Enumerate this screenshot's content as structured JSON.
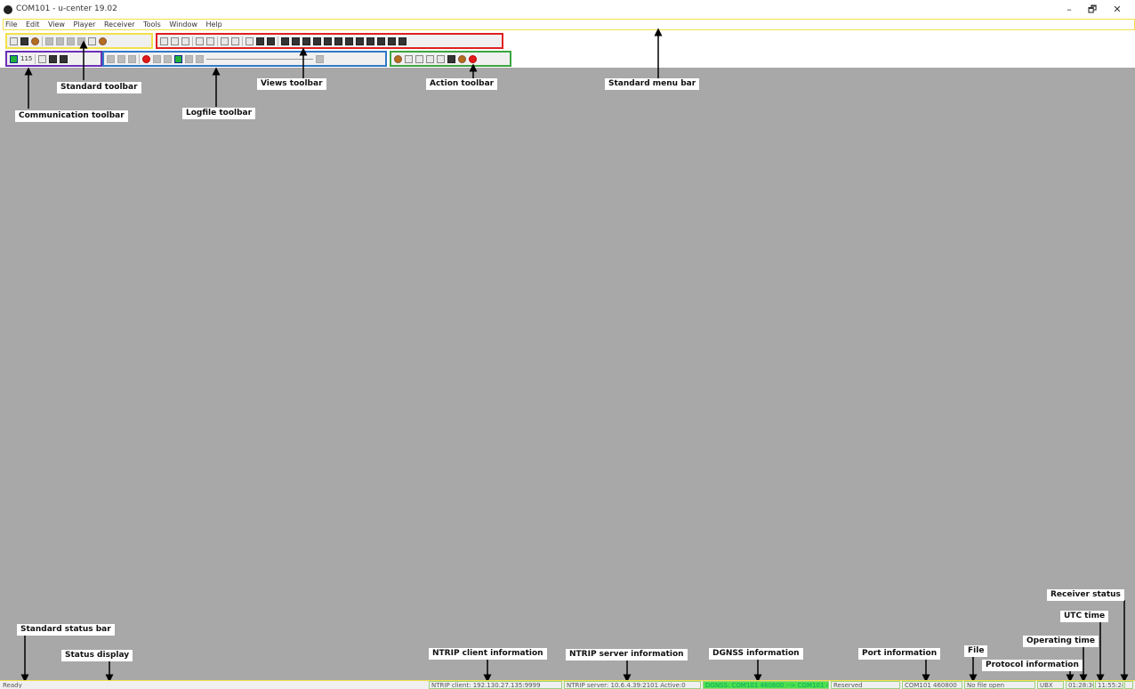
{
  "window": {
    "title": "COM101 - u-center 19.02",
    "controls": [
      "–",
      "🗗",
      "✕"
    ]
  },
  "menu": [
    "File",
    "Edit",
    "View",
    "Player",
    "Receiver",
    "Tools",
    "Window",
    "Help"
  ],
  "comm_toolbar": {
    "baud": "115"
  },
  "annotations": {
    "standard_toolbar": "Standard toolbar",
    "views_toolbar": "Views toolbar",
    "action_toolbar": "Action toolbar",
    "standard_menu_bar": "Standard menu bar",
    "communication_toolbar": "Communication toolbar",
    "logfile_toolbar": "Logfile toolbar",
    "standard_status_bar": "Standard status bar",
    "status_display": "Status display",
    "ntrip_client_information": "NTRIP client information",
    "ntrip_server_information": "NTRIP server information",
    "dgnss_information": "DGNSS information",
    "port_information": "Port information",
    "file": "File",
    "protocol_information": "Protocol information",
    "operating_time": "Operating time",
    "utc_time": "UTC time",
    "receiver_status": "Receiver status"
  },
  "statusbar": {
    "status": "Ready",
    "ntrip_client": "NTRIP client: 192.130.27.135:9999",
    "ntrip_server": "NTRIP server: 10.6.4.39:2101 Active:0",
    "dgnss": "DGNSS: COM101 460800 --> COM101 4",
    "reserved": "Reserved",
    "port": "COM101 460800",
    "file": "No file open",
    "protocol": "UBX",
    "operating_time": "01:28:36",
    "utc_time": "11:55:24"
  },
  "colors": {
    "menu_box": "#f2e14a",
    "standard_toolbar_box": "#f2e14a",
    "views_toolbar_box": "#e02020",
    "communication_toolbar_box": "#6b2fb5",
    "logfile_toolbar_box": "#2f78c8",
    "action_toolbar_box": "#3aa640",
    "workspace": "#a8a8a8",
    "dgnss_field": "#4ee04e"
  }
}
